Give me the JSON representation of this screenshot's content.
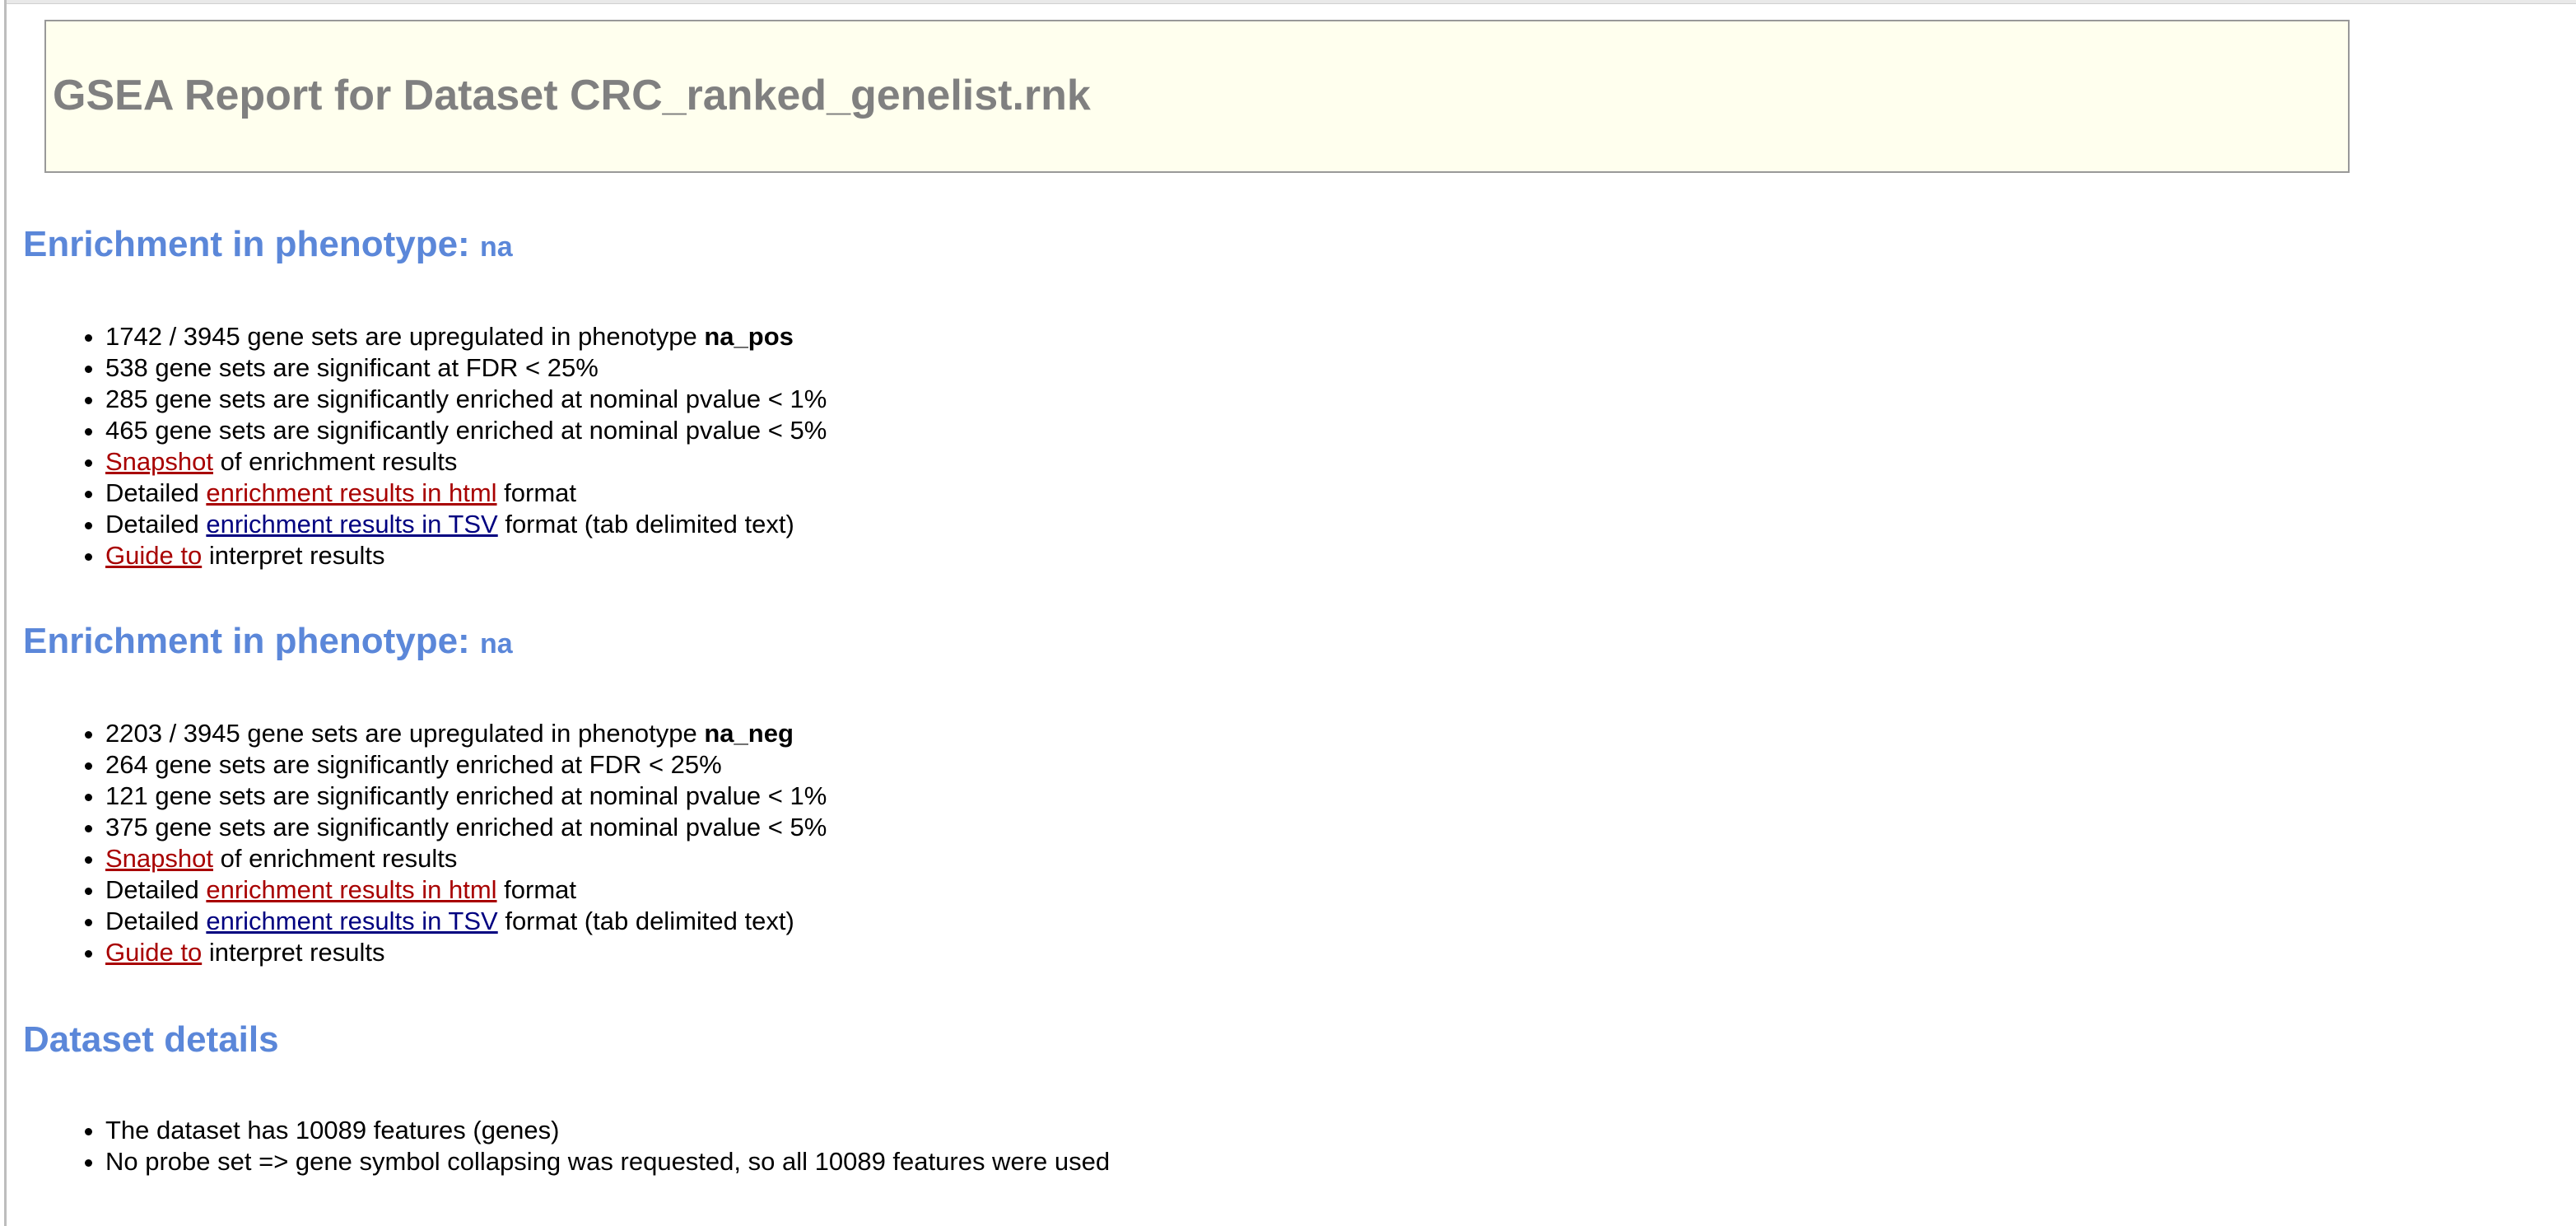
{
  "report": {
    "title": "GSEA Report for Dataset CRC_ranked_genelist.rnk"
  },
  "sections": [
    {
      "heading": "Enrichment in phenotype:",
      "phenotype": "na",
      "items": {
        "upregulated_prefix": "1742 / 3945 gene sets are upregulated in phenotype ",
        "upregulated_phenotype": "na_pos",
        "fdr": "538 gene sets are significant at FDR < 25%",
        "pval1": "285 gene sets are significantly enriched at nominal pvalue < 1%",
        "pval5": "465 gene sets are significantly enriched at nominal pvalue < 5%",
        "snapshot_link": "Snapshot",
        "snapshot_suffix": " of enrichment results",
        "html_prefix": "Detailed ",
        "html_link": "enrichment results in html",
        "html_suffix": " format",
        "tsv_prefix": "Detailed ",
        "tsv_link": "enrichment results in TSV",
        "tsv_suffix": " format (tab delimited text)",
        "guide_link": "Guide to",
        "guide_suffix": " interpret results"
      }
    },
    {
      "heading": "Enrichment in phenotype:",
      "phenotype": "na",
      "items": {
        "upregulated_prefix": "2203 / 3945 gene sets are upregulated in phenotype ",
        "upregulated_phenotype": "na_neg",
        "fdr": "264 gene sets are significantly enriched at FDR < 25%",
        "pval1": "121 gene sets are significantly enriched at nominal pvalue < 1%",
        "pval5": "375 gene sets are significantly enriched at nominal pvalue < 5%",
        "snapshot_link": "Snapshot",
        "snapshot_suffix": " of enrichment results",
        "html_prefix": "Detailed ",
        "html_link": "enrichment results in html",
        "html_suffix": " format",
        "tsv_prefix": "Detailed ",
        "tsv_link": "enrichment results in TSV",
        "tsv_suffix": " format (tab delimited text)",
        "guide_link": "Guide to",
        "guide_suffix": " interpret results"
      }
    }
  ],
  "dataset": {
    "heading": "Dataset details",
    "features": "The dataset has 10089 features (genes)",
    "collapse": "No probe set => gene symbol collapsing was requested, so all 10089 features were used"
  },
  "colors": {
    "heading": "#5b87d9",
    "title": "#808080",
    "header_bg": "#ffffee",
    "link_visited": "#a80000",
    "link": "#000080"
  }
}
